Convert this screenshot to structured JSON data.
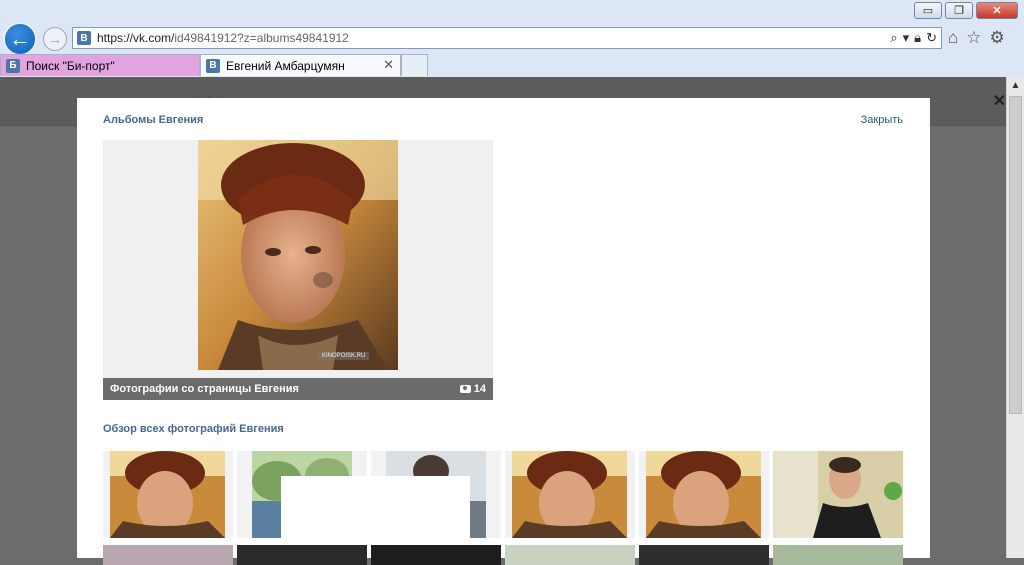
{
  "browser": {
    "url_prefix": "https://vk.com/",
    "url_rest": "id49841912?z=albums49841912",
    "favicon_label": "В",
    "window_controls": {
      "minimize": "▭",
      "restore": "❐",
      "close": "✕"
    },
    "nav": {
      "back_icon": "arrow-left-icon",
      "forward_icon": "arrow-right-icon"
    },
    "tabs": [
      {
        "title": "Поиск \"Би-порт\"",
        "favicon": "Б"
      },
      {
        "title": "Евгений Амбарцумян",
        "favicon": "В",
        "close": "✕"
      }
    ],
    "toolbar_icons": [
      "home-icon",
      "star-icon",
      "gear-icon"
    ]
  },
  "modal": {
    "title": "Альбомы Евгения",
    "close_label": "Закрыть",
    "album": {
      "name": "Фотографии со страницы Евгения",
      "count": "14",
      "watermark": "KINOPOISK.RU"
    },
    "overview_title": "Обзор всех фотографий Евгения"
  },
  "colors": {
    "link": "#45688e",
    "vk_blue": "#4a76a8",
    "overlay": "#6c6c6c"
  }
}
